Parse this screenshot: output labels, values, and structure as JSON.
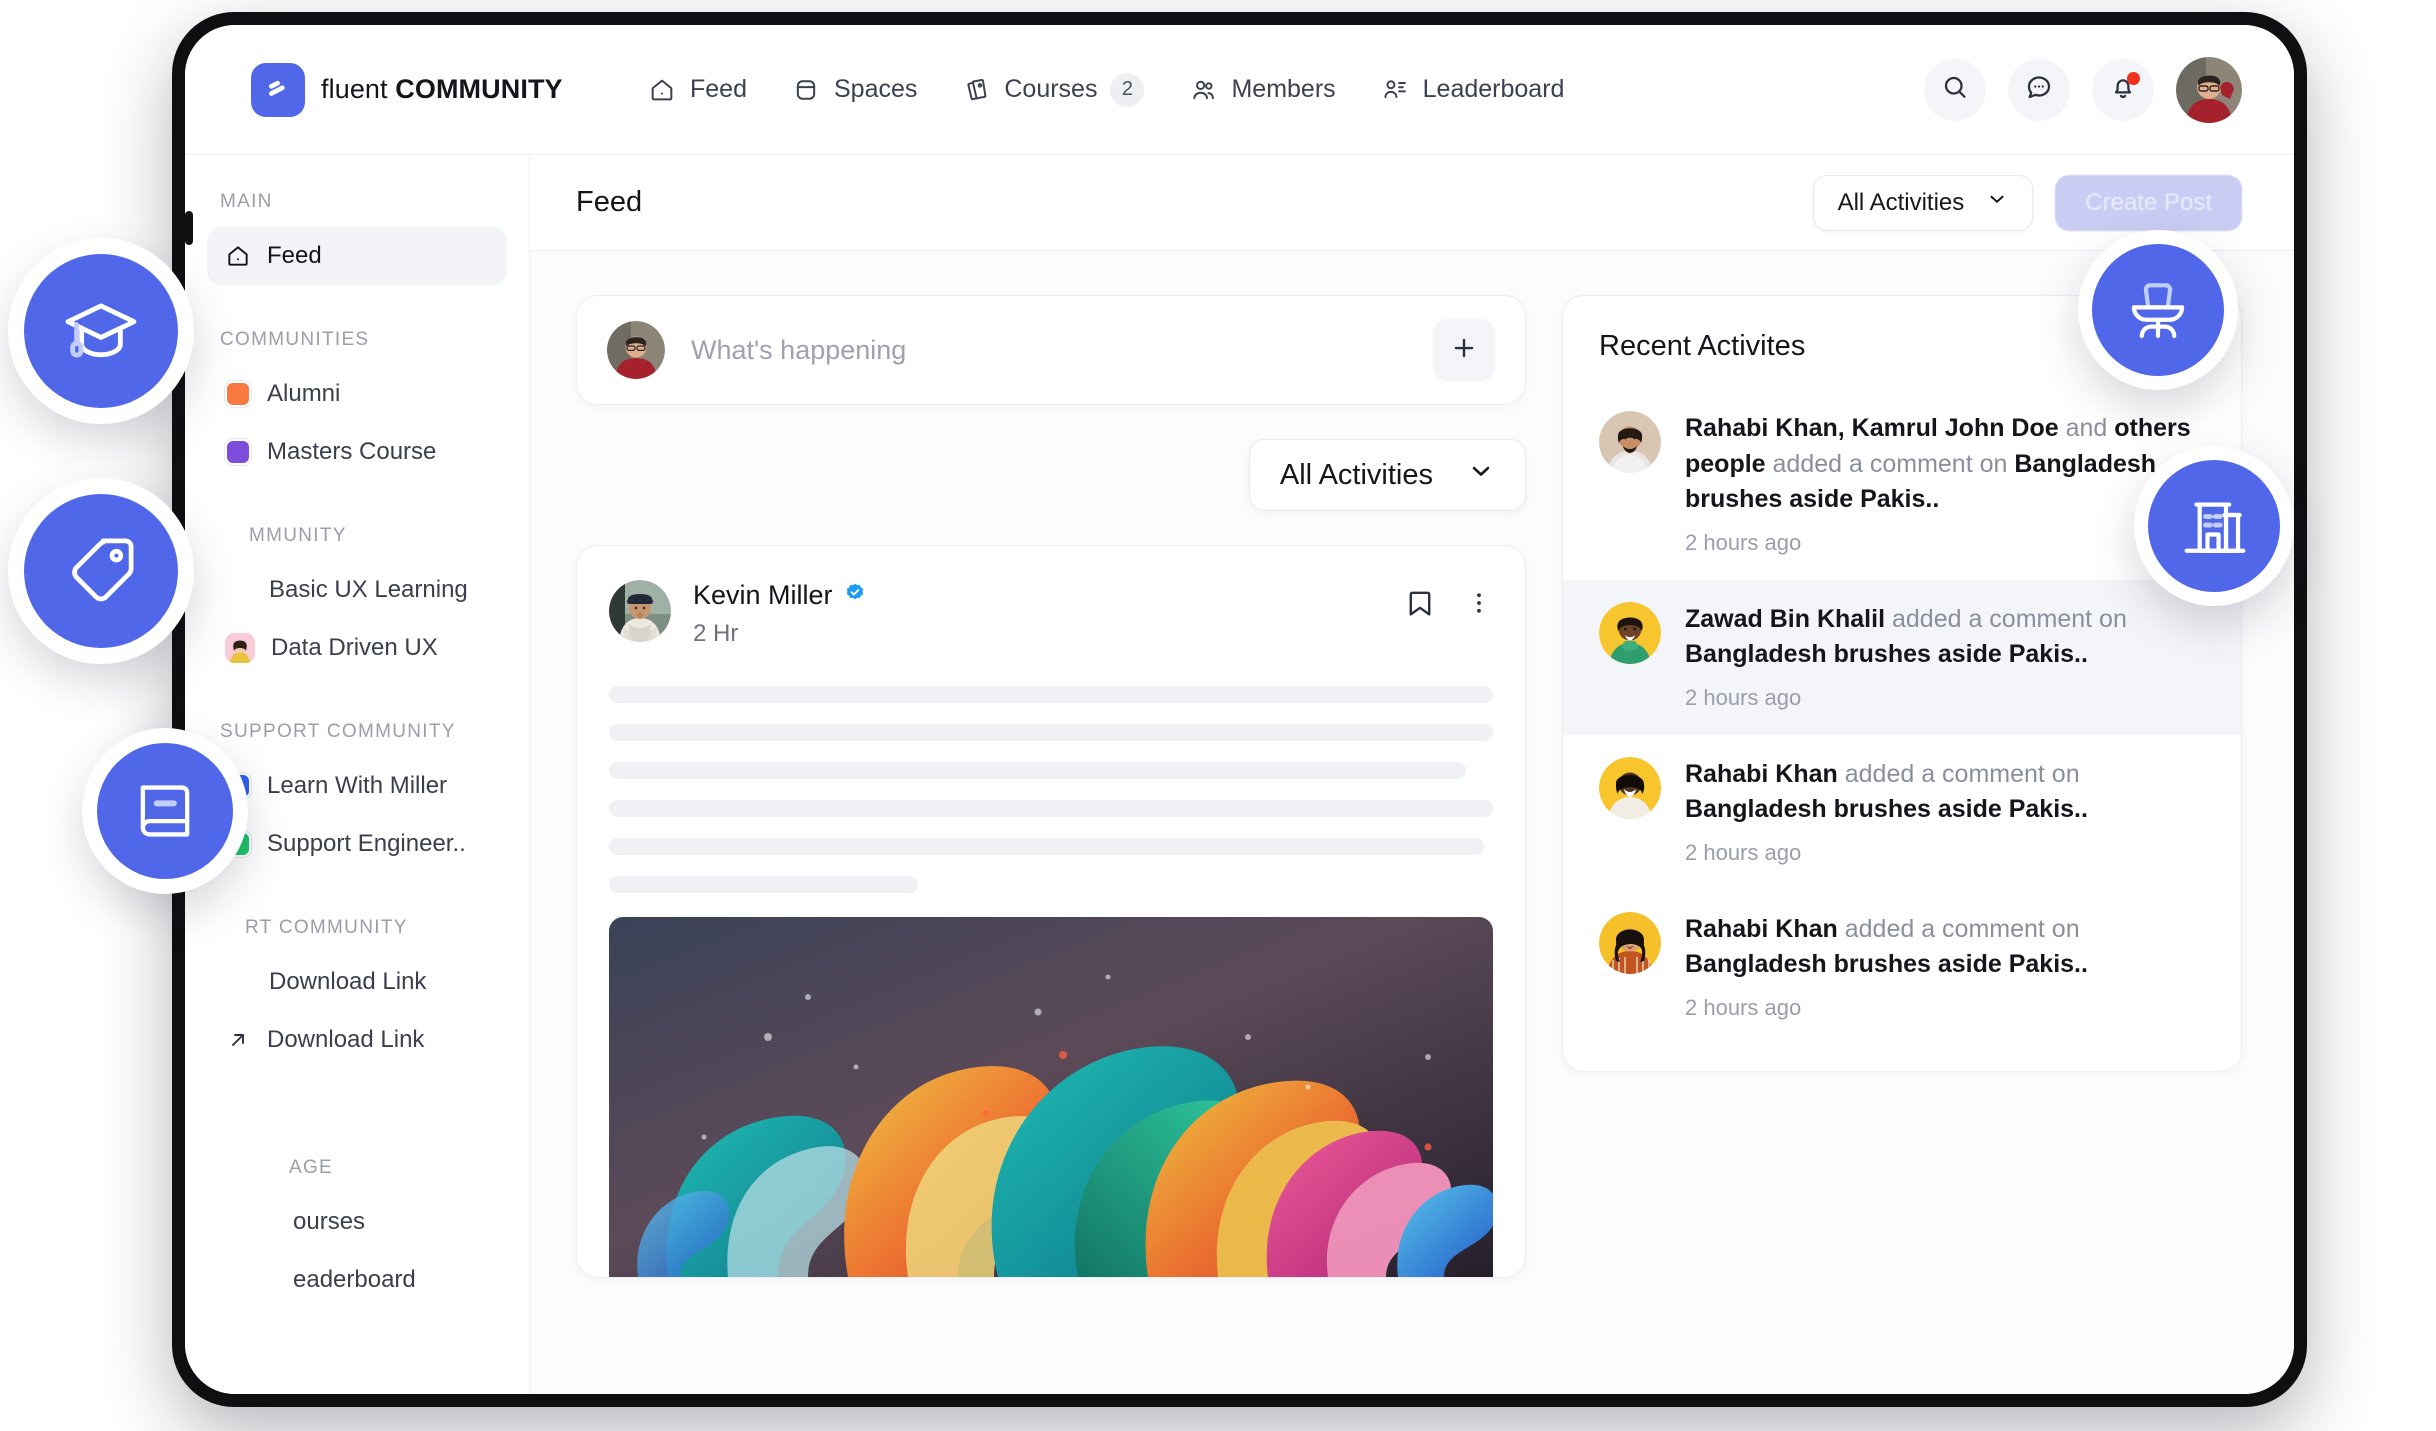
{
  "brand": {
    "word_light": "fluent",
    "word_bold": "COMMUNITY",
    "logo_icon": "fluent-logo-icon",
    "accent": "#4f67e8"
  },
  "topnav": {
    "items": [
      {
        "label": "Feed",
        "icon": "home-icon",
        "badge": ""
      },
      {
        "label": "Spaces",
        "icon": "spaces-icon",
        "badge": ""
      },
      {
        "label": "Courses",
        "icon": "courses-icon",
        "badge": "2"
      },
      {
        "label": "Members",
        "icon": "members-icon",
        "badge": ""
      },
      {
        "label": "Leaderboard",
        "icon": "leaderboard-icon",
        "badge": ""
      }
    ],
    "actions": [
      {
        "name": "search-icon"
      },
      {
        "name": "messages-icon"
      },
      {
        "name": "notifications-icon",
        "has_dot": true
      }
    ],
    "avatar": "user-avatar"
  },
  "sidebar": {
    "groups": [
      {
        "label": "MAIN",
        "items": [
          {
            "label": "Feed",
            "icon": "home-icon",
            "active": true,
            "marker": "none"
          }
        ]
      },
      {
        "label": "COMMUNITIES",
        "items": [
          {
            "label": "Alumni",
            "marker": "swatch",
            "color": "#f97a41"
          },
          {
            "label": "Masters Course",
            "marker": "swatch",
            "color": "#7c4ddb"
          }
        ]
      },
      {
        "label": "MMUNITY",
        "items": [
          {
            "label": "Basic UX Learning",
            "marker": "none"
          },
          {
            "label": "Data Driven UX",
            "marker": "emoji",
            "color": "#f7ccd7"
          }
        ]
      },
      {
        "label": "SUPPORT COMMUNITY",
        "items": [
          {
            "label": "Learn With Miller",
            "marker": "swatch",
            "color": "#2f5ef2"
          },
          {
            "label": "Support Engineer..",
            "marker": "swatch",
            "color": "#1ec46a"
          }
        ]
      },
      {
        "label": "RT COMMUNITY",
        "items": [
          {
            "label": "Download Link",
            "marker": "none"
          },
          {
            "label": "Download Link",
            "marker": "arrow-up-right-icon"
          }
        ]
      },
      {
        "label": "AGE",
        "items": [
          {
            "label": "ourses",
            "marker": "none"
          },
          {
            "label": "eaderboard",
            "marker": "none"
          }
        ]
      }
    ]
  },
  "content": {
    "page_title": "Feed",
    "header_filter": {
      "label": "All Activities",
      "icon": "chevron-down-icon"
    },
    "create_post_label": "Create Post",
    "composer": {
      "placeholder": "What's happening",
      "add_icon": "plus-icon",
      "avatar": "user-avatar"
    },
    "feed_filter": {
      "label": "All Activities",
      "icon": "chevron-down-icon"
    },
    "post": {
      "author": "Kevin Miller",
      "verified": true,
      "time": "2 Hr",
      "bookmark_icon": "bookmark-icon",
      "more_icon": "more-vertical-icon",
      "skeleton_widths": [
        "100%",
        "100%",
        "97%",
        "100%",
        "99%",
        "35%"
      ],
      "media": "paint-splash-image"
    }
  },
  "recent_activities": {
    "title": "Recent Activites",
    "items": [
      {
        "names": "Rahabi Khan, Kamrul John Doe",
        "connector": " and ",
        "names2": "others people",
        "action": " added a comment on ",
        "target": "Bangladesh brushes aside Pakis..",
        "time": "2 hours ago",
        "avatar_bg": "#d8c5b2",
        "highlight": false
      },
      {
        "names": "Zawad Bin Khalil",
        "connector": "",
        "names2": "",
        "action": " added a comment on ",
        "target": "Bangladesh brushes aside Pakis..",
        "time": "2 hours ago",
        "avatar_bg": "#f7c52e",
        "highlight": true
      },
      {
        "names": "Rahabi Khan",
        "connector": "",
        "names2": "",
        "action": " added a comment on ",
        "target": "Bangladesh brushes aside Pakis..",
        "time": "2 hours ago",
        "avatar_bg": "#f9c52c",
        "highlight": false
      },
      {
        "names": "Rahabi Khan",
        "connector": "",
        "names2": "",
        "action": " added a comment on ",
        "target": "Bangladesh brushes aside Pakis..",
        "time": "2 hours ago",
        "avatar_bg": "#f6c02a",
        "highlight": false
      }
    ]
  },
  "floating_badges": [
    {
      "name": "graduation-cap-icon",
      "color": "#4f67e8"
    },
    {
      "name": "tag-icon",
      "color": "#4f67e8"
    },
    {
      "name": "book-icon",
      "color": "#4f67e8"
    },
    {
      "name": "office-chair-icon",
      "color": "#4f67e8"
    },
    {
      "name": "building-icon",
      "color": "#4f67e8"
    }
  ]
}
